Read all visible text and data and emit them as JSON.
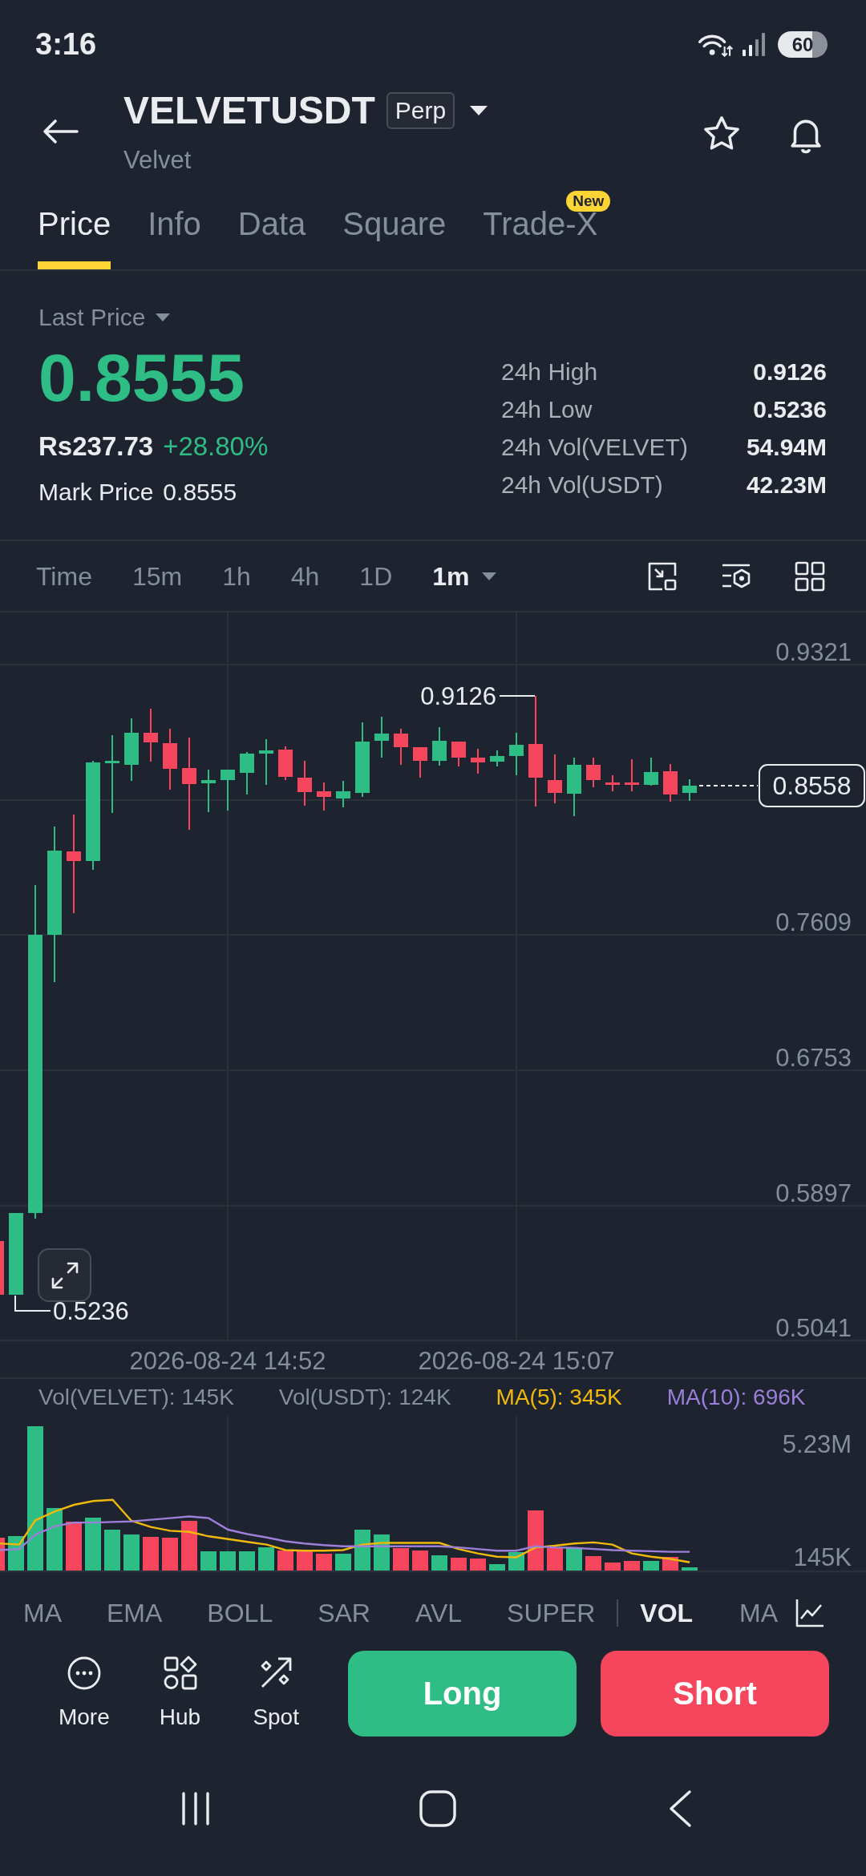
{
  "status_bar": {
    "time": "3:16",
    "battery": "60"
  },
  "header": {
    "symbol": "VELVETUSDT",
    "contract_badge": "Perp",
    "name": "Velvet"
  },
  "tabs": [
    {
      "label": "Price",
      "selected": true
    },
    {
      "label": "Info",
      "selected": false
    },
    {
      "label": "Data",
      "selected": false
    },
    {
      "label": "Square",
      "selected": false
    },
    {
      "label": "Trade-X",
      "selected": false,
      "badge": "New"
    }
  ],
  "price_summary": {
    "price_type": "Last Price",
    "last_price": "0.8555",
    "fiat_price": "Rs237.73",
    "change": "+28.80%",
    "mark_price_label": "Mark Price",
    "mark_price": "0.8555"
  },
  "stats": [
    {
      "label": "24h High",
      "value": "0.9126"
    },
    {
      "label": "24h Low",
      "value": "0.5236"
    },
    {
      "label": "24h Vol(VELVET)",
      "value": "54.94M"
    },
    {
      "label": "24h Vol(USDT)",
      "value": "42.23M"
    }
  ],
  "timeframes": [
    {
      "label": "Time",
      "selected": false,
      "kind": "option"
    },
    {
      "label": "15m",
      "selected": false,
      "kind": "option"
    },
    {
      "label": "1h",
      "selected": false,
      "kind": "option"
    },
    {
      "label": "4h",
      "selected": false,
      "kind": "option"
    },
    {
      "label": "1D",
      "selected": false,
      "kind": "option"
    },
    {
      "label": "1m",
      "selected": true,
      "kind": "dropdown"
    }
  ],
  "price_chart": {
    "axis_labels": [
      "0.9321",
      "0.7609",
      "0.6753",
      "0.5897",
      "0.5041"
    ],
    "current_price": "0.8558",
    "high_label": "0.9126",
    "low_label": "0.5236",
    "time_labels": [
      "2026-08-24 14:52",
      "2026-08-24 15:07"
    ]
  },
  "volume_chart": {
    "legend": [
      {
        "text": "Vol(VELVET): 145K",
        "color": "#848e9c"
      },
      {
        "text": "Vol(USDT): 124K",
        "color": "#848e9c"
      },
      {
        "text": "MA(5): 345K",
        "color": "#f0b90b"
      },
      {
        "text": "MA(10): 696K",
        "color": "#9c7fd9"
      }
    ],
    "axis_labels": [
      "5.23M",
      "145K"
    ]
  },
  "indicators": {
    "main": [
      {
        "label": "MA",
        "selected": false
      },
      {
        "label": "EMA",
        "selected": false
      },
      {
        "label": "BOLL",
        "selected": false
      },
      {
        "label": "SAR",
        "selected": false
      },
      {
        "label": "AVL",
        "selected": false
      },
      {
        "label": "SUPER",
        "selected": false
      }
    ],
    "sub": [
      {
        "label": "VOL",
        "selected": true
      },
      {
        "label": "MA",
        "selected": false
      }
    ]
  },
  "actions": [
    {
      "label": "More",
      "kind": "more"
    },
    {
      "label": "Hub",
      "kind": "hub"
    },
    {
      "label": "Spot",
      "kind": "spot"
    }
  ],
  "trade_buttons": [
    {
      "label": "Long",
      "kind": "long"
    },
    {
      "label": "Short",
      "kind": "short"
    }
  ]
}
